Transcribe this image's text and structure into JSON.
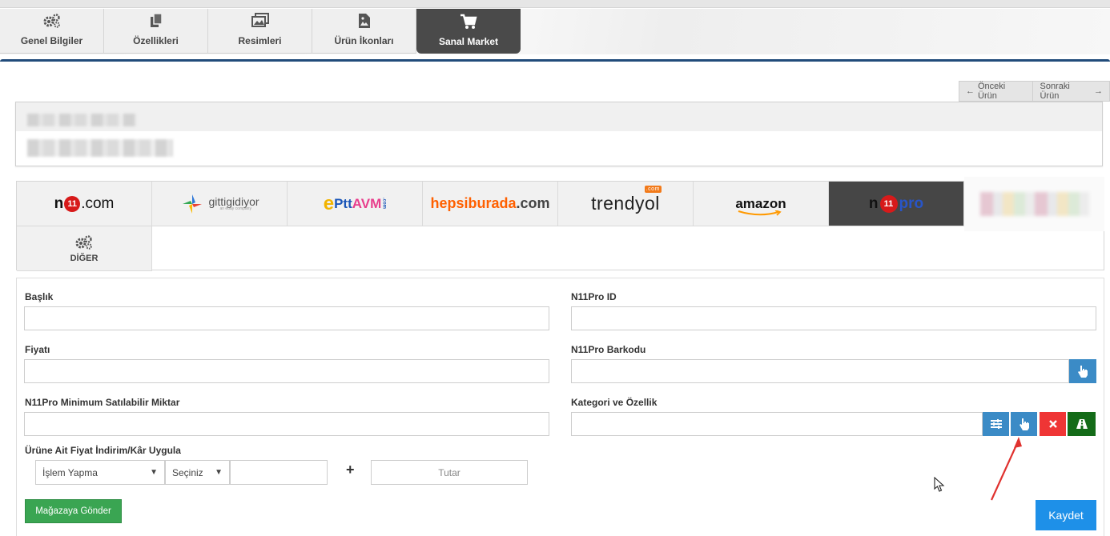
{
  "tabs": [
    {
      "label": "Genel Bilgiler",
      "icon": "gears-icon",
      "active": false
    },
    {
      "label": "Özellikleri",
      "icon": "copy-icon",
      "active": false
    },
    {
      "label": "Resimleri",
      "icon": "images-icon",
      "active": false
    },
    {
      "label": "Ürün İkonları",
      "icon": "file-image-icon",
      "active": false
    },
    {
      "label": "Sanal Market",
      "icon": "cart-icon",
      "active": true
    }
  ],
  "nav": {
    "prev": "Önceki Ürün",
    "next": "Sonraki Ürün"
  },
  "markets": {
    "n11": {
      "pre": "n",
      "mid": "11",
      "suf": ".com"
    },
    "gittigidiyor": {
      "name": "gittigidiyor",
      "sub": "an ebay company"
    },
    "pttavm": {
      "e": "e",
      "ptt": "Ptt",
      "avm": "AVM",
      "com": ".com"
    },
    "hepsiburada": {
      "name": "hepsiburada",
      "suf": ".com"
    },
    "trendyol": {
      "name": "trendyol",
      "badge": ".com"
    },
    "amazon": {
      "name": "amazon"
    },
    "n11pro": {
      "pre": "n",
      "mid": "11",
      "suf": "pro",
      "active": true
    },
    "other": {
      "label": "DİĞER"
    }
  },
  "form": {
    "baslik": {
      "label": "Başlık",
      "value": ""
    },
    "fiyat": {
      "label": "Fiyatı",
      "value": ""
    },
    "min_miktar": {
      "label": "N11Pro Minimum Satılabilir Miktar",
      "value": ""
    },
    "indirim": {
      "label": "Ürüne Ait Fiyat İndirim/Kâr Uygula",
      "islem": "İşlem Yapma",
      "secim": "Seçiniz",
      "oran": "",
      "plus": "+",
      "tutar_placeholder": "Tutar"
    },
    "n11pro_id": {
      "label": "N11Pro ID",
      "value": ""
    },
    "barkod": {
      "label": "N11Pro Barkodu",
      "value": ""
    },
    "kategori": {
      "label": "Kategori ve Özellik",
      "value": ""
    }
  },
  "buttons": {
    "send": "Mağazaya Gönder",
    "save": "Kaydet"
  },
  "colors": {
    "blue": "#3b8bc6",
    "red": "#ef3535",
    "green": "#146b18",
    "save": "#1e90e8",
    "send": "#3aa552",
    "active_tab": "#4a4a4a",
    "accent_line": "#214b7a"
  }
}
